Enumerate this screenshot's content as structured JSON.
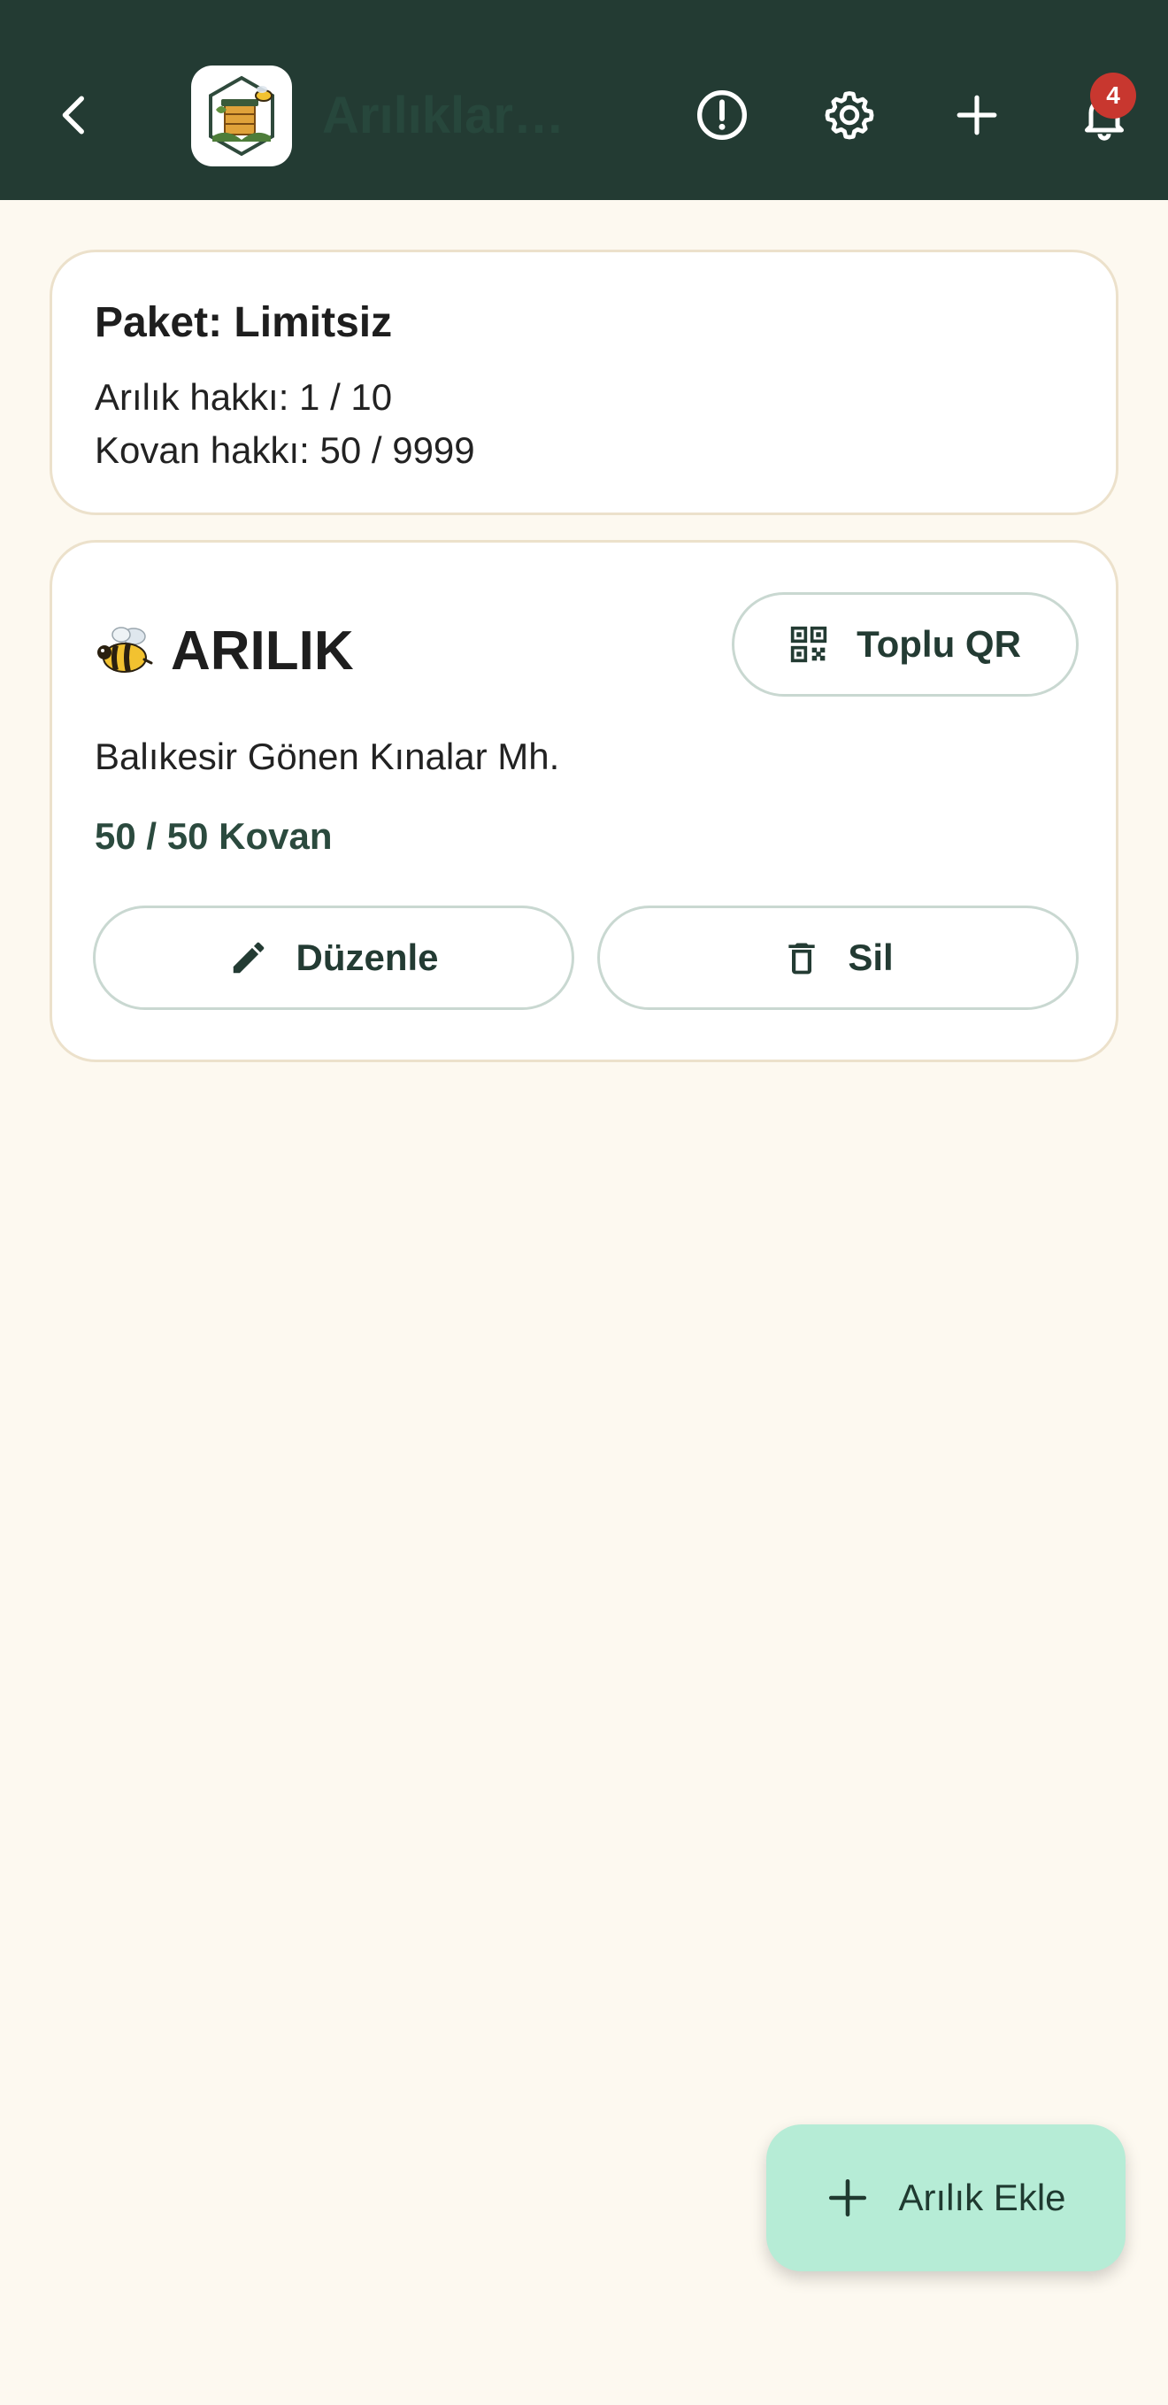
{
  "appbar": {
    "title": "Arılıklar…",
    "notification_count": "4",
    "icons": [
      "back-arrow-icon",
      "info-icon",
      "gear-icon",
      "plus-icon",
      "bell-icon"
    ]
  },
  "package": {
    "title": "Paket: Limitsiz",
    "apiary_quota": "Arılık hakkı: 1 / 10",
    "hive_quota": "Kovan hakkı: 50 / 9999"
  },
  "apiaries": [
    {
      "name": "ARILIK",
      "location": "Balıkesir Gönen Kınalar Mh.",
      "hive_count": "50 / 50 Kovan",
      "qr_label": "Toplu QR",
      "edit_label": "Düzenle",
      "delete_label": "Sil"
    }
  ],
  "fab": {
    "label": "Arılık Ekle"
  },
  "colors": {
    "appbar": "#233b33",
    "background": "#fdf9f0",
    "accent_text": "#2b4a3e",
    "fab": "#b6ecd6",
    "badge": "#c8372f"
  }
}
